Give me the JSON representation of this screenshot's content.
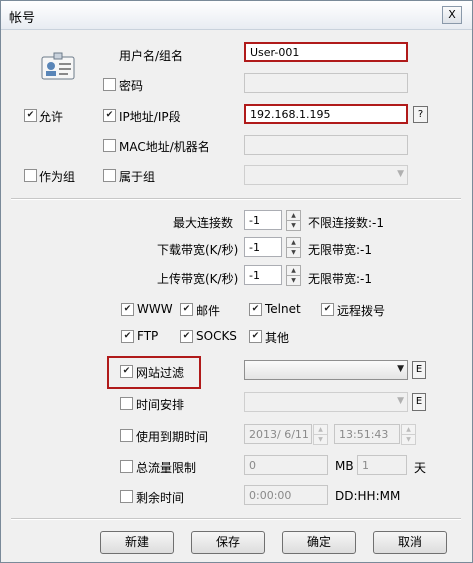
{
  "window": {
    "title": "帐号",
    "close_label": "X"
  },
  "account": {
    "username_label": "用户名/组名",
    "username_value": "User-001",
    "password_label": "密码",
    "allow_label": "允许",
    "ip_label": "IP地址/IP段",
    "ip_value": "192.168.1.195",
    "ip_help": "?",
    "mac_label": "MAC地址/机器名",
    "as_group_label": "作为组",
    "belongs_group_label": "属于组"
  },
  "limits": {
    "max_conn_label": "最大连接数",
    "max_conn_value": "-1",
    "max_conn_hint": "不限连接数:-1",
    "download_label": "下载带宽(K/秒)",
    "download_value": "-1",
    "download_hint": "无限带宽:-1",
    "upload_label": "上传带宽(K/秒)",
    "upload_value": "-1",
    "upload_hint": "无限带宽:-1"
  },
  "services": {
    "www": "WWW",
    "mail": "邮件",
    "telnet": "Telnet",
    "remote_dial": "远程拨号",
    "ftp": "FTP",
    "socks": "SOCKS",
    "other": "其他"
  },
  "filters": {
    "web_filter_label": "网站过滤",
    "e_label": "E",
    "schedule_label": "时间安排",
    "expiry_label": "使用到期时间",
    "expiry_date": "2013/ 6/11",
    "expiry_time": "13:51:43",
    "traffic_label": "总流量限制",
    "traffic_value": "0",
    "traffic_unit_value": "1",
    "mb_label": "MB",
    "tian_label": "天",
    "remaining_label": "剩余时间",
    "remaining_value": "0:00:00",
    "remaining_format": "DD:HH:MM"
  },
  "buttons": {
    "new": "新建",
    "save": "保存",
    "ok": "确定",
    "cancel": "取消"
  },
  "colors": {
    "highlight": "#b01a1a"
  }
}
